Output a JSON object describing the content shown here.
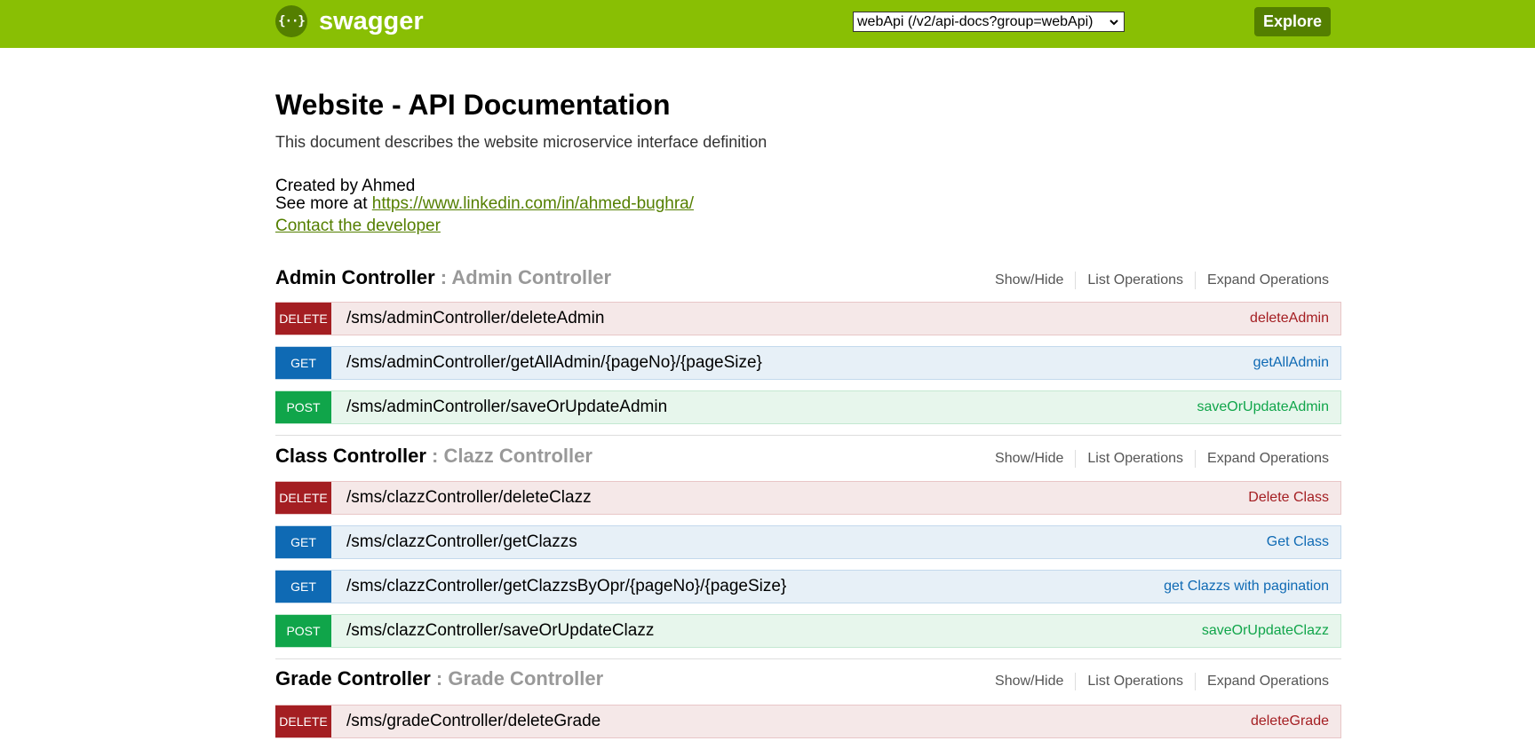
{
  "header": {
    "logo_mark": "{··}",
    "logo_text": "swagger",
    "api_select_value": "webApi (/v2/api-docs?group=webApi)",
    "explore_label": "Explore"
  },
  "info": {
    "title": "Website - API Documentation",
    "description": "This document describes the website microservice interface definition",
    "created_by": "Created by Ahmed",
    "see_more_prefix": "See more at ",
    "see_more_link": "https://www.linkedin.com/in/ahmed-bughra/",
    "contact_label": "Contact the developer"
  },
  "section_links": {
    "show_hide": "Show/Hide",
    "list_operations": "List Operations",
    "expand_operations": "Expand Operations"
  },
  "sections": [
    {
      "name": "Admin Controller",
      "description": " : Admin Controller",
      "operations": [
        {
          "method": "DELETE",
          "path": "/sms/adminController/deleteAdmin",
          "summary": "deleteAdmin"
        },
        {
          "method": "GET",
          "path": "/sms/adminController/getAllAdmin/{pageNo}/{pageSize}",
          "summary": "getAllAdmin"
        },
        {
          "method": "POST",
          "path": "/sms/adminController/saveOrUpdateAdmin",
          "summary": "saveOrUpdateAdmin"
        }
      ]
    },
    {
      "name": "Class Controller",
      "description": " : Clazz Controller",
      "operations": [
        {
          "method": "DELETE",
          "path": "/sms/clazzController/deleteClazz",
          "summary": "Delete Class"
        },
        {
          "method": "GET",
          "path": "/sms/clazzController/getClazzs",
          "summary": "Get Class"
        },
        {
          "method": "GET",
          "path": "/sms/clazzController/getClazzsByOpr/{pageNo}/{pageSize}",
          "summary": "get Clazzs with pagination"
        },
        {
          "method": "POST",
          "path": "/sms/clazzController/saveOrUpdateClazz",
          "summary": "saveOrUpdateClazz"
        }
      ]
    },
    {
      "name": "Grade Controller",
      "description": " : Grade Controller",
      "operations": [
        {
          "method": "DELETE",
          "path": "/sms/gradeController/deleteGrade",
          "summary": "deleteGrade"
        }
      ]
    }
  ],
  "colors": {
    "header_bg": "#89bf04",
    "explore_bg": "#547f00",
    "delete": "#a41e22",
    "get": "#0f6ab4",
    "post": "#10a54a"
  }
}
